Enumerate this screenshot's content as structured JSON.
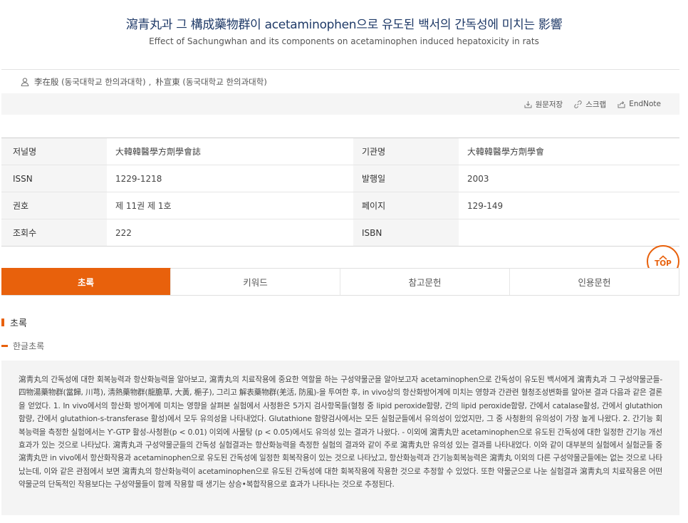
{
  "article": {
    "title_ko": "瀉青丸과 그 構成藥物群이 acetaminophen으로 유도된 백서의 간독성에 미치는 影響",
    "title_en": "Effect of Sachungwhan and its components on acetaminophen induced hepatoxicity in rats",
    "authors": [
      "李在殷 (동국대학교 한의과대학)",
      "朴宣東 (동국대학교 한의과대학)"
    ],
    "author_separator": ","
  },
  "toolbar": {
    "actions": [
      {
        "label": "원문저장",
        "icon": "download-icon"
      },
      {
        "label": "스크랩",
        "icon": "link-icon"
      },
      {
        "label": "EndNote",
        "icon": "export-icon"
      }
    ]
  },
  "info": {
    "rows": [
      {
        "label1": "저널명",
        "value1": "大韓韓醫學方劑學會誌",
        "label2": "기관명",
        "value2": "大韓韓醫學方劑學會"
      },
      {
        "label1": "ISSN",
        "value1": "1229-1218",
        "label2": "발행일",
        "value2": "2003"
      },
      {
        "label1": "권호",
        "value1": "제 11권 제 1호",
        "label2": "페이지",
        "value2": "129-149"
      },
      {
        "label1": "조회수",
        "value1": "222",
        "label2": "ISBN",
        "value2": ""
      }
    ]
  },
  "tabs": [
    {
      "label": "초록",
      "active": true
    },
    {
      "label": "키워드",
      "active": false
    },
    {
      "label": "참고문헌",
      "active": false
    },
    {
      "label": "인용문헌",
      "active": false
    }
  ],
  "top_button": {
    "label": "TOP"
  },
  "abstract": {
    "section_title": "초록",
    "sub_title": "한글초록",
    "text": "瀉靑丸의 간독성에 대한 회복능력과 항산화능력을 알아보고, 瀉靑丸의 치료작용에 중요한 역할을 하는 구성약물군을 알아보고자 acetaminophen으로 간독성이 유도된 백서에게 瀉靑丸과 그 구성약물군들-四物湯藥物群(當歸, 川芎), 淸熱藥物群(龍膽草, 大黃, 梔子), 그리고 解表藥物群(羌活, 防風)-을 투여한 후, in vivo상의 항산화방어계에 미치는 영향과 간관련 혈청조성변화를 알아본 결과 다음과 같은 결론을 얻었다. 1. In vivo에서의 항산화 방어계에 미치는 영향을 살펴본 실험에서 사청환은 5가지 검사항목들(혈청 중 lipid peroxide함량, 간의 lipid peroxide함량, 간에서 catalase활성, 간에서 glutathion 함량, 간에서 glutathion-s-transferase 활성)에서 모두 유의성을 나타내었다. Glutathione 함량검사에서는 모든 실험군들에서 유의성이 있었지만, 그 중 사청환의 유의성이 가장 높게 나왔다. 2. 간기능 회복능력을 측정한 실험에서는 Ƴ-GTP 활성-사청환(p < 0.01) 이외에 사물탕 (p < 0.05)에서도 유의성 있는 결과가 나왔다. - 이외에 瀉靑丸만 acetaminophen으로 유도된 간독성에 대한 일정한 간기능 개선 효과가 있는 것으로 나타났다. 瀉靑丸과 구성약물군들의 간독성 실험결과는 항산화능력을 측정한 실험의 결과와 같이 주로 瀉靑丸만 유의성 있는 결과를 나타내었다. 이와 같이 대부분의 실험에서 실험군들 중 瀉靑丸만 in vivo에서 항산화작용과 acetaminophen으로 유도된 간독성에 일정한 회복작용이 있는 것으로 나타났고, 항산화능력과 간기능회복능력은 瀉靑丸 이외의 다른 구성약물군들에는 없는 것으로 나타났는데, 이와 같은 관점에서 보면 瀉靑丸의 항산화능력이 acetaminophen으로 유도된 간독성에 대한 회복작용에 작용한 것으로 추정할 수 있었다. 또한 약물군으로 나눈 실험결과 瀉靑丸의 치료작용은 어떤 약물군의 단독적인 작용보다는 구성약물들이 함께 작용할 때 생기는 상승•복합작용으로 효과가 나타나는 것으로 추정된다."
  },
  "colors": {
    "accent": "#e8610c",
    "title": "#1f3a68",
    "panel_bg": "#f4f4f4"
  }
}
